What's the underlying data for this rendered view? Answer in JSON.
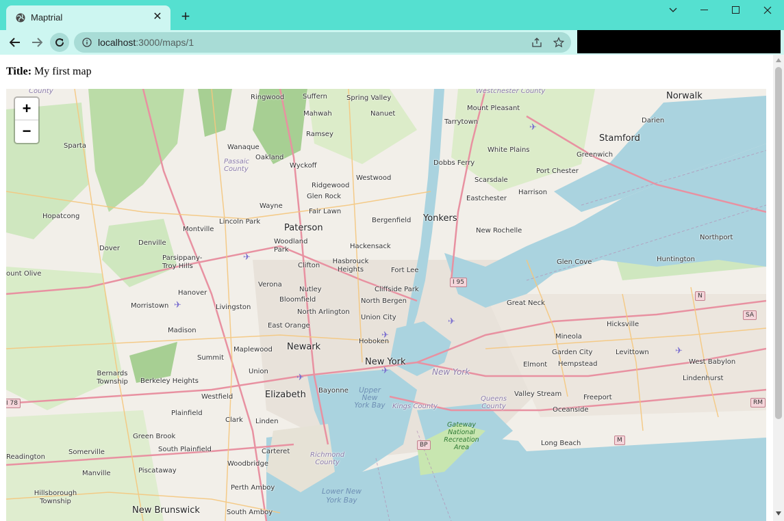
{
  "browser": {
    "tab_title": "Maptrial",
    "tab_close": "✕",
    "new_tab": "+",
    "url_host": "localhost",
    "url_path": ":3000/maps/1"
  },
  "page": {
    "title_label": "Title:",
    "title_value": " My first map"
  },
  "map": {
    "zoom_in": "+",
    "zoom_out": "−",
    "colors": {
      "water": "#aad3df",
      "land": "#f2efe9",
      "park": "#c8e6b0",
      "forest": "#a7cf93",
      "urban": "#e8e2da",
      "motorway": "#e891a1",
      "primary": "#f5c77e"
    },
    "labels": {
      "norwalk": "Norwalk",
      "stamford": "Stamford",
      "darien": "Darien",
      "greenwich": "Greenwich",
      "port_chester": "Port Chester",
      "harrison": "Harrison",
      "white_plains": "White Plains",
      "mount_pleasant": "Mount Pleasant",
      "westchester_county": "Westchester County",
      "tarrytown": "Tarrytown",
      "dobbs_ferry": "Dobbs Ferry",
      "scarsdale": "Scarsdale",
      "eastchester": "Eastchester",
      "yonkers": "Yonkers",
      "new_rochelle": "New Rochelle",
      "spring_valley": "Spring Valley",
      "nanuet": "Nanuet",
      "suffern": "Suffern",
      "mahwah": "Mahwah",
      "ringwood": "Ringwood",
      "ramsey": "Ramsey",
      "wyckoff": "Wyckoff",
      "oakland": "Oakland",
      "wanaque": "Wanaque",
      "passaic_county": "Passaic County",
      "sparta": "Sparta",
      "westwood": "Westwood",
      "ridgewood": "Ridgewood",
      "glen_rock": "Glen Rock",
      "fair_lawn": "Fair Lawn",
      "wayne": "Wayne",
      "bergenfield": "Bergenfield",
      "paterson": "Paterson",
      "lincoln_park": "Lincoln Park",
      "montville": "Montville",
      "hopatcong": "Hopatcong",
      "denville": "Denville",
      "dover": "Dover",
      "parsippany": "Parsippany-Troy Hills",
      "woodland_park": "Woodland Park",
      "hackensack": "Hackensack",
      "clifton": "Clifton",
      "hasbrouck_heights": "Hasbrouck Heights",
      "fort_lee": "Fort Lee",
      "i95": "I 95",
      "glen_cove": "Glen Cove",
      "huntington": "Huntington",
      "northport": "Northport",
      "n_shield": "N",
      "sa_shield": "SA",
      "mount_olive": "ount Olive",
      "verona": "Verona",
      "hanover": "Hanover",
      "morristown": "Morristown",
      "livingston": "Livingston",
      "nutley": "Nutley",
      "bloomfield": "Bloomfield",
      "cliffside_park": "Cliffside Park",
      "north_bergen": "North Bergen",
      "great_neck": "Great Neck",
      "north_arlington": "North Arlington",
      "union_city": "Union City",
      "hicksville": "Hicksville",
      "east_orange": "East Orange",
      "madison": "Madison",
      "newark": "Newark",
      "hoboken": "Hoboken",
      "mineola": "Mineola",
      "levittown": "Levittown",
      "maplewood": "Maplewood",
      "summit": "Summit",
      "new_york": "New York",
      "new_york_county": "New York",
      "garden_city": "Garden City",
      "west_babylon": "West Babylon",
      "bernards_township": "Bernards Township",
      "berkeley_heights": "Berkeley Heights",
      "union": "Union",
      "hempstead": "Hempstead",
      "elmont": "Elmont",
      "lindenhurst": "Lindenhurst",
      "i78": "I 78",
      "westfield": "Westfield",
      "elizabeth": "Elizabeth",
      "bayonne": "Bayonne",
      "upper_ny_bay": "Upper New York Bay",
      "valley_stream": "Valley Stream",
      "freeport": "Freeport",
      "rm_shield": "RM",
      "kings_county": "Kings County",
      "queens_county": "Queens County",
      "plainfield": "Plainfield",
      "clark": "Clark",
      "oceanside": "Oceanside",
      "gateway": "Gateway National Recreation Area",
      "linden": "Linden",
      "green_brook": "Green Brook",
      "bp_shield": "BP",
      "m_shield": "M",
      "long_beach": "Long Beach",
      "south_plainfield": "South Plainfield",
      "carteret": "Carteret",
      "readington": "Readington",
      "somerville": "Somerville",
      "richmond_county": "Richmond County",
      "woodbridge": "Woodbridge",
      "manville": "Manville",
      "piscataway": "Piscataway",
      "perth_amboy": "Perth Amboy",
      "hillsborough": "Hillsborough Township",
      "lower_ny_bay": "Lower New York Bay",
      "new_brunswick": "New Brunswick",
      "south_amboy": "South Amboy",
      "county_top": "County"
    }
  }
}
